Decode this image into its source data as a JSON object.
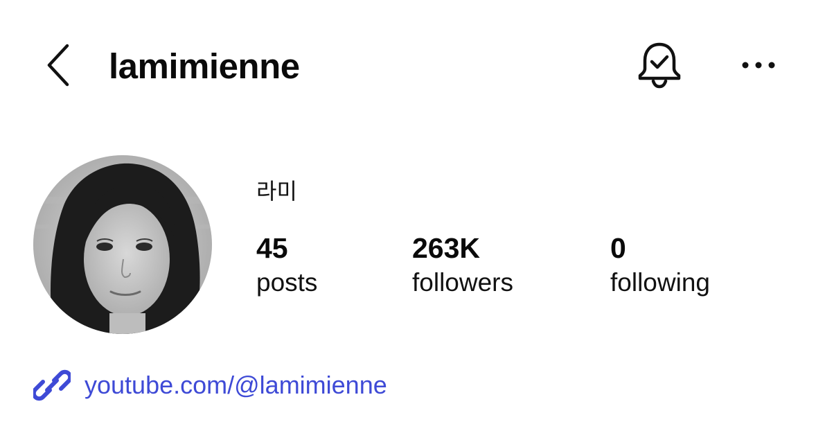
{
  "header": {
    "back_icon": "chevron-left-icon",
    "username": "lamimienne",
    "notification_icon": "bell-check-icon",
    "more_icon": "more-horizontal-icon"
  },
  "profile": {
    "avatar_alt": "profile photo",
    "display_name": "라미",
    "stats": [
      {
        "count": "45",
        "label": "posts"
      },
      {
        "count": "263K",
        "label": "followers"
      },
      {
        "count": "0",
        "label": "following"
      }
    ]
  },
  "link": {
    "icon": "link-icon",
    "text": "youtube.com/@lamimienne",
    "color": "#3e4ad6"
  }
}
